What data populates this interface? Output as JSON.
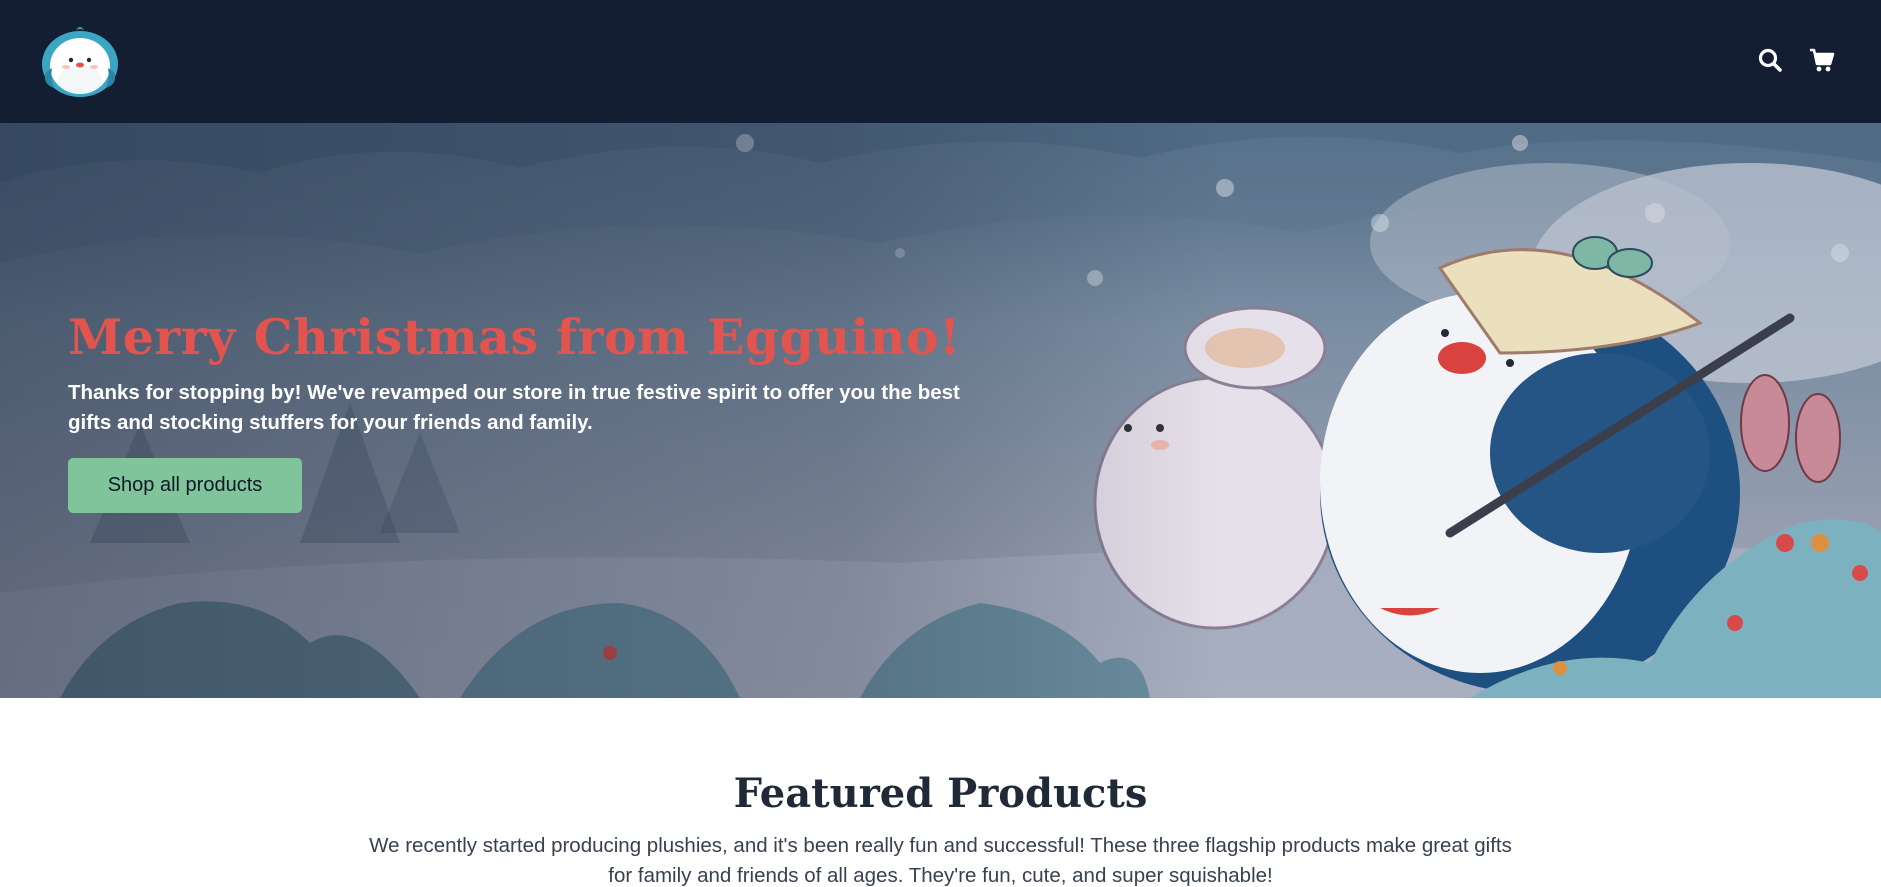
{
  "header": {
    "logo_icon": "penguin-logo-icon",
    "search_icon": "search-icon",
    "cart_icon": "cart-icon"
  },
  "hero": {
    "title": "Merry Christmas from Egguino!",
    "text": "Thanks for stopping by! We've revamped our store in true festive spirit to offer you the best gifts and stocking stuffers for your friends and family.",
    "button_label": "Shop all products",
    "title_color": "#e4544f",
    "button_color": "#7fc49b"
  },
  "featured": {
    "title": "Featured Products",
    "description": "We recently started producing plushies, and it's been really fun and successful! These three flagship products make great gifts for family and friends of all ages. They're fun, cute, and super squishable!"
  },
  "colors": {
    "header_bg": "#141e33",
    "text_dark": "#1f2937"
  }
}
